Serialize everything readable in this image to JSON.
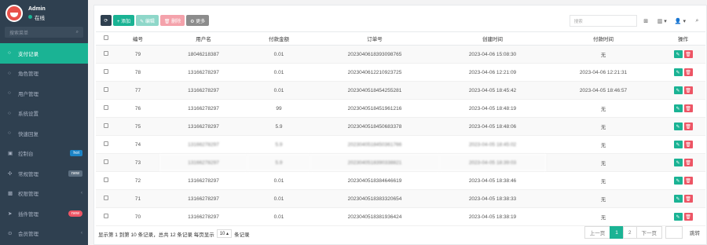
{
  "profile": {
    "name": "Admin",
    "status": "在线"
  },
  "sidebar": {
    "search_placeholder": "搜索菜单",
    "items": [
      {
        "label": "支付记录",
        "icon": "○"
      },
      {
        "label": "角色管理",
        "icon": "○"
      },
      {
        "label": "用户管理",
        "icon": "○"
      },
      {
        "label": "系统设置",
        "icon": "○"
      },
      {
        "label": "快速回复",
        "icon": "○"
      },
      {
        "label": "控制台",
        "icon": "▣",
        "badge": "hot"
      },
      {
        "label": "常规管理",
        "icon": "✣",
        "badge": "new"
      },
      {
        "label": "权限管理",
        "icon": "▩",
        "chevron": "‹"
      },
      {
        "label": "插件管理",
        "icon": "➤",
        "badge": "new"
      },
      {
        "label": "会员管理",
        "icon": "⊙",
        "chevron": "‹"
      }
    ]
  },
  "toolbar": {
    "refresh": "⟳",
    "add": "+ 添加",
    "edit": "✎ 编辑",
    "delete": "🗑 删除",
    "more": "⚙ 更多"
  },
  "tools": {
    "search_placeholder": "搜索",
    "export": "⊞",
    "columns": "▥ ▾",
    "user": "👤 ▾",
    "search": "⌕"
  },
  "table": {
    "headers": [
      "",
      "编号",
      "用户名",
      "付款金额",
      "订单号",
      "创建时间",
      "付款时间",
      "操作"
    ],
    "rows": [
      {
        "id": "79",
        "user": "18046218387",
        "amount": "0.01",
        "order": "2023040618393098765",
        "created": "2023-04-06 15:08:30",
        "paid": "无"
      },
      {
        "id": "78",
        "user": "13166278297",
        "amount": "0.01",
        "order": "2023040612210923725",
        "created": "2023-04-06 12:21:09",
        "paid": "2023-04-06 12:21:31"
      },
      {
        "id": "77",
        "user": "13166278297",
        "amount": "0.01",
        "order": "2023040518454255281",
        "created": "2023-04-05 18:45:42",
        "paid": "2023-04-05 18:46:57"
      },
      {
        "id": "76",
        "user": "13166278297",
        "amount": "99",
        "order": "2023040518451961216",
        "created": "2023-04-05 18:48:19",
        "paid": "无"
      },
      {
        "id": "75",
        "user": "13166278297",
        "amount": "5.9",
        "order": "2023040518450683378",
        "created": "2023-04-05 18:48:06",
        "paid": "无"
      },
      {
        "id": "74",
        "user": "13166278297",
        "amount": "5.9",
        "order": "2023040518450361766",
        "created": "2023-04-05 18:45:02",
        "paid": "无",
        "blur": true
      },
      {
        "id": "73",
        "user": "13166278297",
        "amount": "5.9",
        "order": "2023040518390338821",
        "created": "2023-04-05 18:39:03",
        "paid": "无",
        "blur": true
      },
      {
        "id": "72",
        "user": "13166278297",
        "amount": "0.01",
        "order": "2023040518384646619",
        "created": "2023-04-05 18:38:46",
        "paid": "无"
      },
      {
        "id": "71",
        "user": "13166278297",
        "amount": "0.01",
        "order": "2023040518383320654",
        "created": "2023-04-05 18:38:33",
        "paid": "无"
      },
      {
        "id": "70",
        "user": "13166278297",
        "amount": "0.01",
        "order": "2023040518381936424",
        "created": "2023-04-05 18:38:19",
        "paid": "无"
      }
    ]
  },
  "footer": {
    "summary": "显示第 1 到第 10 条记录，总共 12 条记录 每页显示",
    "page_size": "10 ▴",
    "suffix": "条记录"
  },
  "pagination": {
    "prev": "上一页",
    "pages": [
      "1",
      "2"
    ],
    "next": "下一页",
    "jump": "跳转"
  },
  "colors": {
    "accent": "#1ab394",
    "sidebar_bg": "#2f4050",
    "danger": "#ed5565"
  }
}
